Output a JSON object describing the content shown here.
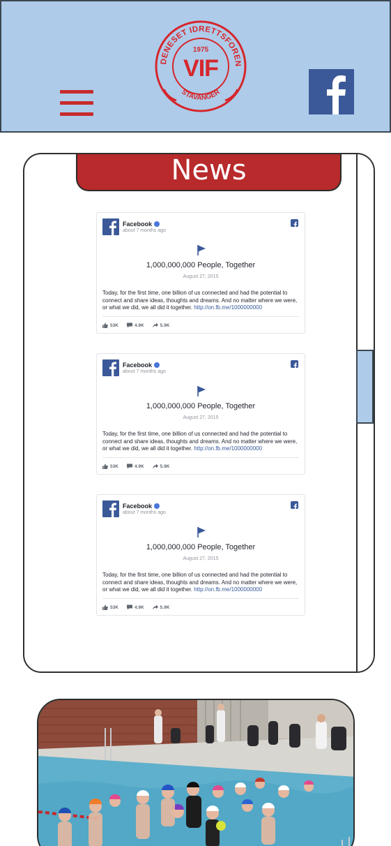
{
  "header": {
    "logo": {
      "ring_text": "VARDENESET IDRETTSFORENING",
      "year": "1975",
      "initials": "VIF",
      "city": "STAVANGER",
      "color": "#d6262b"
    },
    "menu_icon": "hamburger-icon",
    "social_icon": "facebook-icon",
    "background": "#aecbe9"
  },
  "news": {
    "title": "News",
    "posts": [
      {
        "page_name": "Facebook",
        "time": "about 7 months ago",
        "headline": "1,000,000,000 People, Together",
        "date": "August 27, 2015",
        "body": "Today, for the first time, one billion of us connected and had the potential to connect and share ideas, thoughts and dreams. And no matter where we were, or what we did, we all did it together.",
        "link": "http://on.fb.me/1000000000",
        "likes": "53K",
        "comments": "4.9K",
        "shares": "5.9K"
      },
      {
        "page_name": "Facebook",
        "time": "about 7 months ago",
        "headline": "1,000,000,000 People, Together",
        "date": "August 27, 2015",
        "body": "Today, for the first time, one billion of us connected and had the potential to connect and share ideas, thoughts and dreams. And no matter where we were, or what we did, we all did it together.",
        "link": "http://on.fb.me/1000000000",
        "likes": "53K",
        "comments": "4.9K",
        "shares": "5.9K"
      },
      {
        "page_name": "Facebook",
        "time": "about 7 months ago",
        "headline": "1,000,000,000 People, Together",
        "date": "August 27, 2015",
        "body": "Today, for the first time, one billion of us connected and had the potential to connect and share ideas, thoughts and dreams. And no matter where we were, or what we did, we all did it together.",
        "link": "http://on.fb.me/1000000000",
        "likes": "53K",
        "comments": "4.9K",
        "shares": "5.9K"
      }
    ]
  },
  "colors": {
    "accent_red": "#b82a2b",
    "header_blue": "#aecbe9",
    "facebook_blue": "#3b5998"
  }
}
